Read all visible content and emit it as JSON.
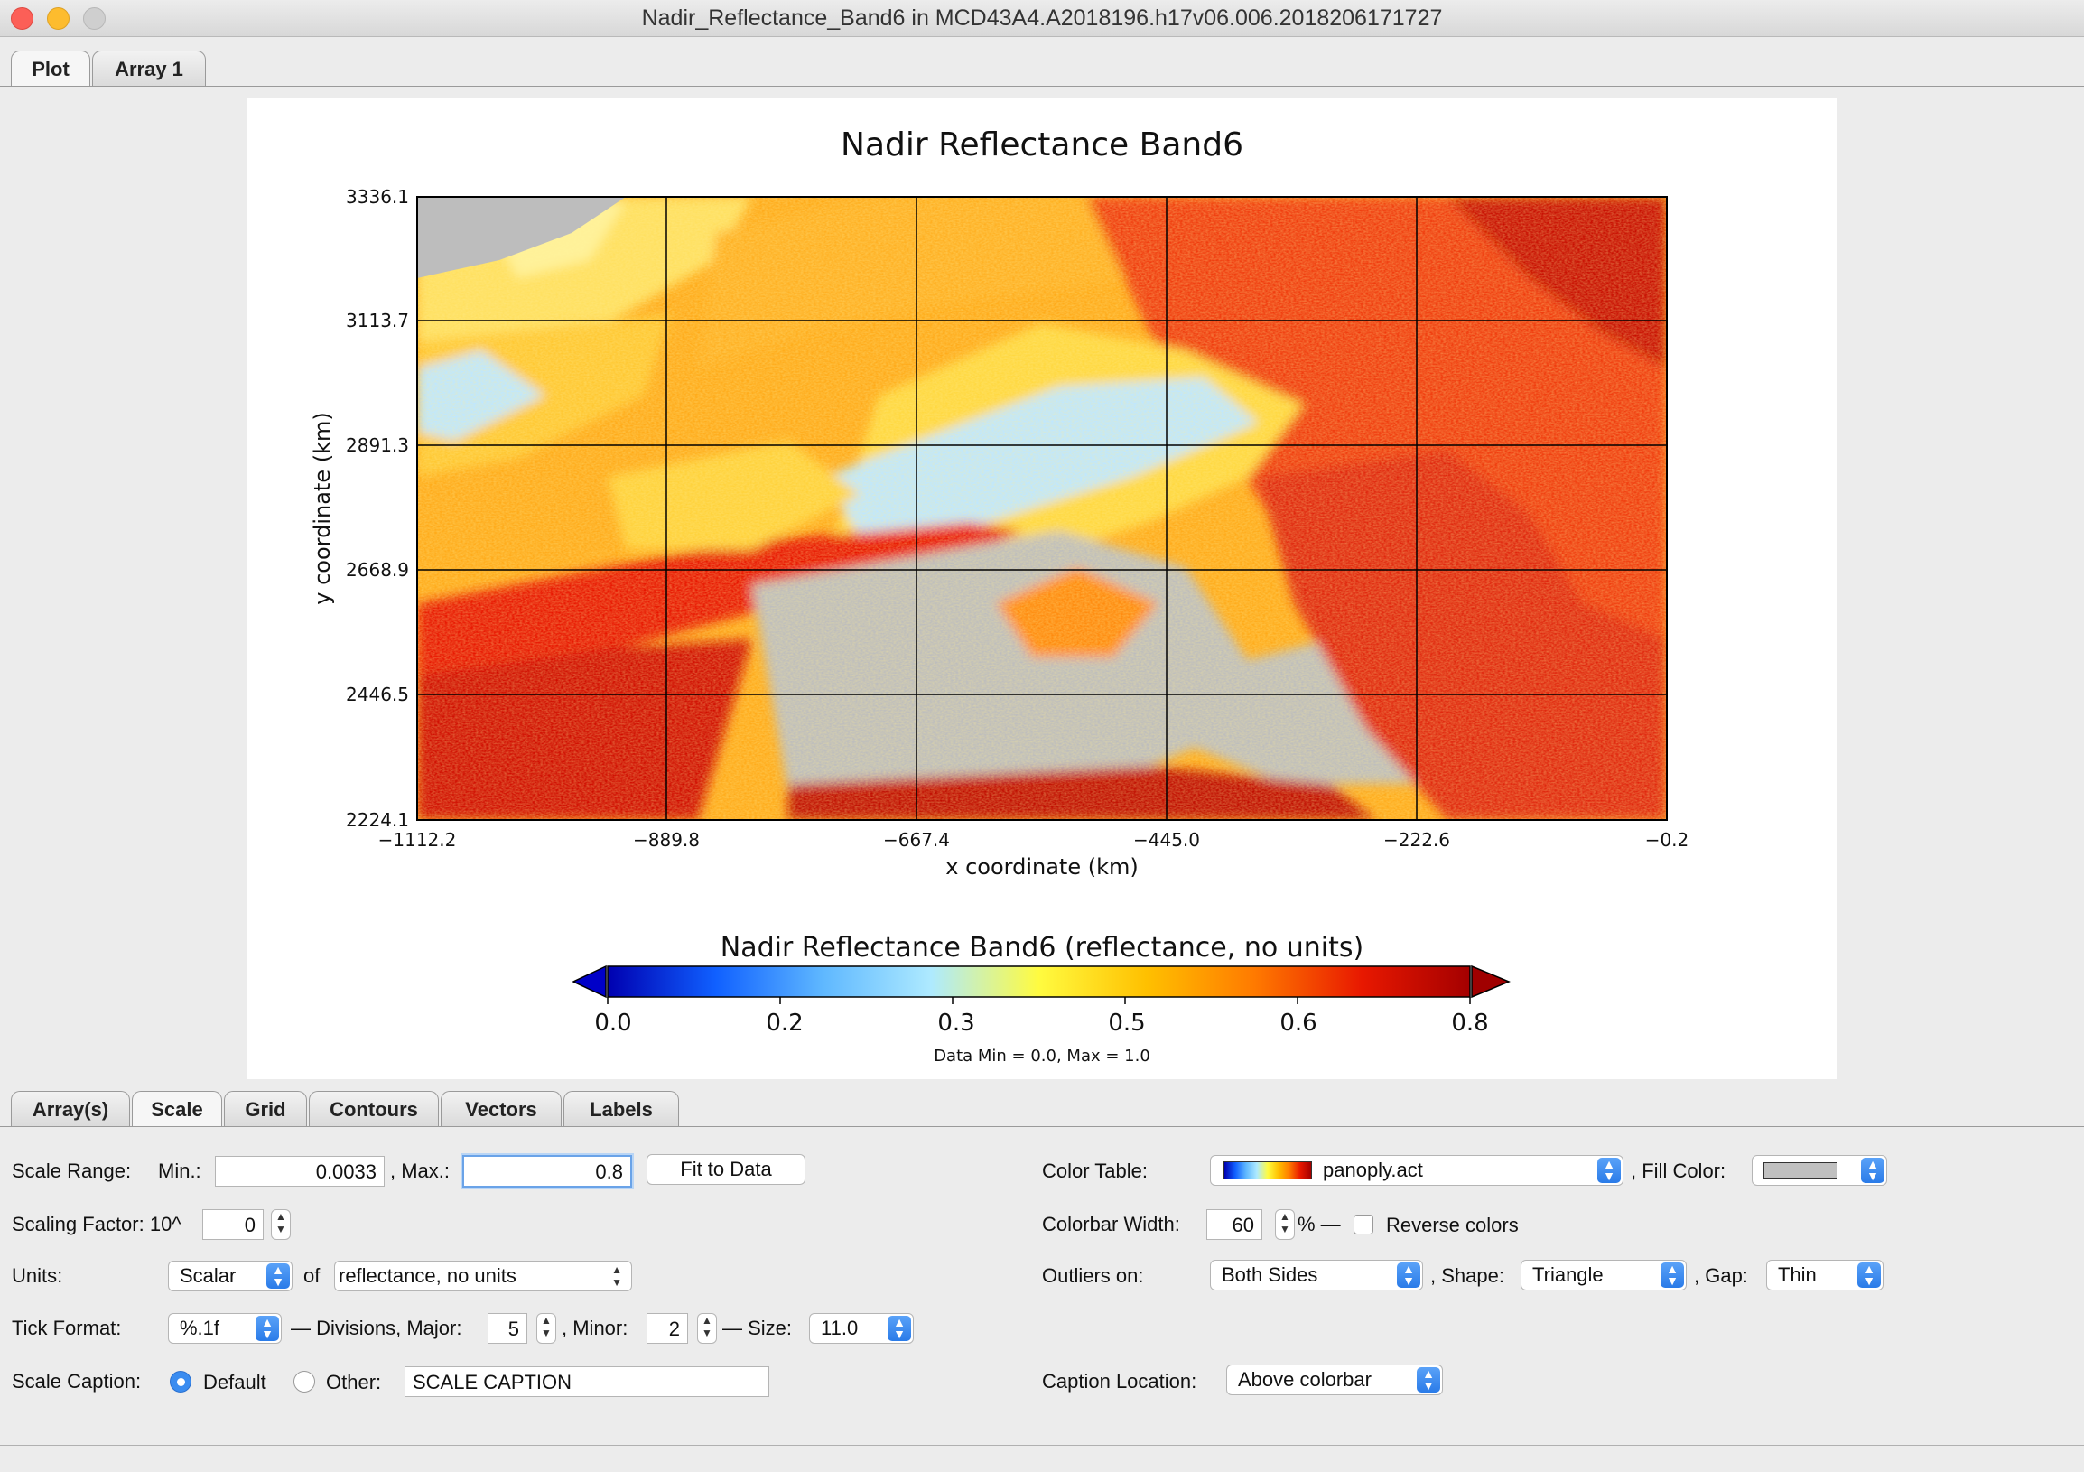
{
  "window": {
    "title": "Nadir_Reflectance_Band6 in MCD43A4.A2018196.h17v06.006.2018206171727"
  },
  "top_tabs": [
    {
      "label": "Plot"
    },
    {
      "label": "Array 1"
    }
  ],
  "bottom_tabs": [
    {
      "label": "Array(s)"
    },
    {
      "label": "Scale"
    },
    {
      "label": "Grid"
    },
    {
      "label": "Contours"
    },
    {
      "label": "Vectors"
    },
    {
      "label": "Labels"
    }
  ],
  "chart_data": {
    "type": "heatmap",
    "title": "Nadir Reflectance Band6",
    "xlabel": "x coordinate (km)",
    "ylabel": "y coordinate (km)",
    "x_ticks": [
      "−1112.2",
      "−889.8",
      "−667.4",
      "−445.0",
      "−222.6",
      "−0.2"
    ],
    "y_ticks": [
      "3336.1",
      "3113.7",
      "2891.3",
      "2668.9",
      "2446.5",
      "2224.1"
    ],
    "xlim": [
      -1112.2,
      -0.2
    ],
    "ylim": [
      2224.1,
      3336.1
    ],
    "grid": true,
    "colorbar": {
      "caption": "Nadir Reflectance Band6 (reflectance, no units)",
      "ticks": [
        "0.0",
        "0.2",
        "0.3",
        "0.5",
        "0.6",
        "0.8"
      ],
      "range": [
        0.0033,
        0.8
      ],
      "colors": [
        "#0000b0",
        "#1060ff",
        "#5fb8ff",
        "#aeeaff",
        "#fffb40",
        "#ffc000",
        "#ff7a00",
        "#e81800",
        "#a40000"
      ],
      "outliers": "both",
      "stats": "Data Min = 0.0, Max = 1.0"
    }
  },
  "scale": {
    "range_label": "Scale Range:",
    "min_label": "Min.:",
    "min_value": "0.0033",
    "max_label": ", Max.:",
    "max_value": "0.8",
    "fit_button": "Fit to Data",
    "factor_label": "Scaling Factor: 10^",
    "factor_value": "0",
    "units_label": "Units:",
    "units_type": "Scalar",
    "of_label": "of",
    "units_value": "reflectance, no units",
    "tick_format_label": "Tick Format:",
    "tick_format_value": "%.1f",
    "divisions_label": "— Divisions, Major:",
    "major_value": "5",
    "minor_label": ", Minor:",
    "minor_value": "2",
    "size_label": "— Size:",
    "size_value": "11.0",
    "caption_label": "Scale Caption:",
    "caption_default": "Default",
    "caption_other": "Other:",
    "caption_other_value": "SCALE CAPTION"
  },
  "color": {
    "table_label": "Color Table:",
    "table_value": "panoply.act",
    "fill_label": ", Fill Color:",
    "fill_color": "#c0c0c0",
    "width_label": "Colorbar Width:",
    "width_value": "60",
    "width_unit": "% —",
    "reverse_label": "Reverse colors",
    "outliers_label": "Outliers on:",
    "outliers_value": "Both Sides",
    "shape_label": ", Shape:",
    "shape_value": "Triangle",
    "gap_label": ", Gap:",
    "gap_value": "Thin",
    "caption_loc_label": "Caption Location:",
    "caption_loc_value": "Above colorbar"
  }
}
